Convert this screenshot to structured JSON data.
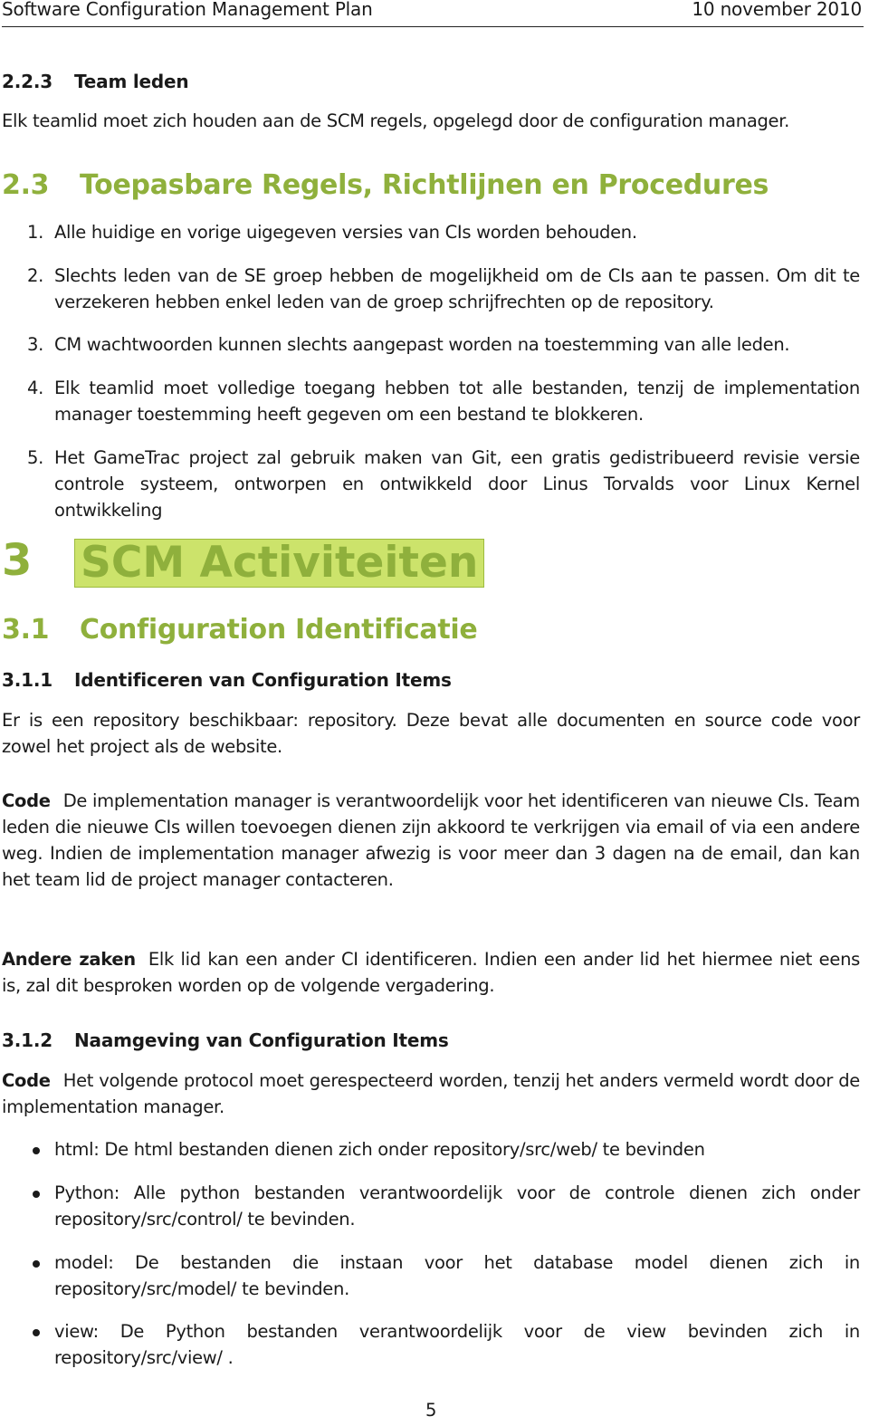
{
  "header": {
    "title": "Software Configuration Management Plan",
    "date": "10 november 2010"
  },
  "sec_2_2_3": {
    "number": "2.2.3",
    "title": "Team leden",
    "text": "Elk teamlid moet zich houden aan de SCM regels, opgelegd door de configuration manager."
  },
  "sec_2_3": {
    "number": "2.3",
    "title": "Toepasbare Regels, Richtlijnen en Procedures",
    "items": [
      {
        "num": "1.",
        "text": "Alle huidige en vorige uigegeven versies van CIs worden behouden."
      },
      {
        "num": "2.",
        "text": "Slechts leden van de SE groep hebben de mogelijkheid om de CIs aan te passen. Om dit te verzekeren hebben enkel leden van de groep schrijfrechten op de repository."
      },
      {
        "num": "3.",
        "text": "CM wachtwoorden kunnen slechts aangepast worden na toestemming van alle leden."
      },
      {
        "num": "4.",
        "text": "Elk teamlid moet volledige toegang hebben tot alle bestanden, tenzij de implementation manager toestemming heeft gegeven om een bestand te blokkeren."
      },
      {
        "num": "5.",
        "text": "Het GameTrac project zal gebruik maken van Git, een gratis gedistribueerd revisie versie controle systeem, ontworpen en ontwikkeld door Linus Torvalds voor Linux Kernel ontwikkeling"
      }
    ]
  },
  "sec_3": {
    "number": "3",
    "title": "SCM Activiteiten"
  },
  "sec_3_1": {
    "number": "3.1",
    "title": "Configuration Identificatie"
  },
  "sec_3_1_1": {
    "number": "3.1.1",
    "title": "Identificeren van Configuration Items",
    "intro": "Er is een repository beschikbaar: repository. Deze bevat alle documenten en source code voor zowel het project als de website.",
    "code_label": "Code",
    "code_text": "De implementation manager is verantwoordelijk voor het identificeren van nieuwe CIs. Team leden die nieuwe CIs willen toevoegen dienen zijn akkoord te verkrijgen via email of via een andere weg. Indien de implementation manager afwezig is voor meer dan 3 dagen na de email, dan kan het team lid de project manager contacteren.",
    "other_label": "Andere zaken",
    "other_text": "Elk lid kan een ander CI identificeren. Indien een ander lid het hiermee niet eens is, zal dit besproken worden op de volgende vergadering."
  },
  "sec_3_1_2": {
    "number": "3.1.2",
    "title": "Naamgeving van Configuration Items",
    "code_label": "Code",
    "code_text": "Het volgende protocol moet gerespecteerd worden, tenzij het anders vermeld wordt door de implementation manager.",
    "bullets": [
      "html: De html bestanden dienen zich onder repository/src/web/ te bevinden",
      "Python: Alle python bestanden verantwoordelijk voor de controle dienen zich onder repository/src/control/ te bevinden.",
      "model: De bestanden die instaan voor het database model dienen zich in repository/src/model/ te bevinden.",
      "view: De Python bestanden verantwoordelijk voor de view bevinden zich in repository/src/view/ ."
    ]
  },
  "footer": {
    "page_number": "5"
  }
}
